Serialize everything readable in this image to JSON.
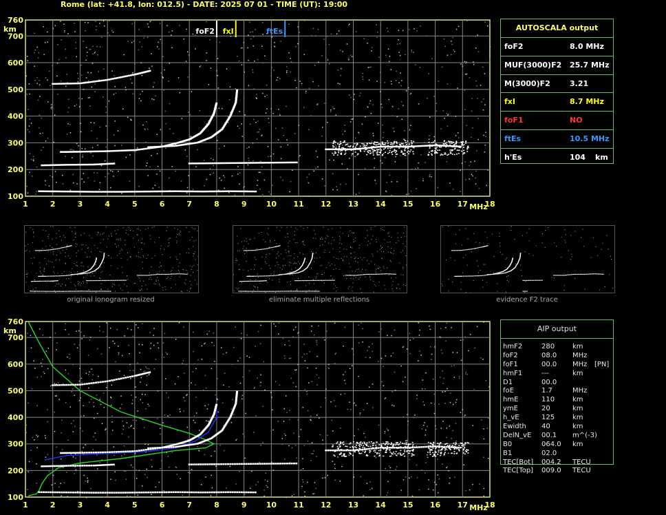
{
  "header": "Rome (lat: +41.8, lon: 012.5) - DATE: 2025 07 01 - TIME (UT): 19:00",
  "axis": {
    "y_ticks": [
      100,
      200,
      300,
      400,
      500,
      600,
      700,
      760
    ],
    "x_ticks": [
      1,
      2,
      3,
      4,
      5,
      6,
      7,
      8,
      9,
      10,
      11,
      12,
      13,
      14,
      15,
      16,
      17,
      18
    ],
    "y_unit": "km",
    "x_unit": "MHz"
  },
  "markers": {
    "foF2": {
      "label": "foF2",
      "freq": 8.0,
      "color": "#ffffff"
    },
    "fxI": {
      "label": "fxI",
      "freq": 8.7,
      "color": "#ffff00"
    },
    "ftEs": {
      "label": "ftEs",
      "freq": 10.5,
      "color": "#3399ff"
    }
  },
  "chart_data": [
    {
      "type": "scatter",
      "title": "",
      "xlabel": "MHz",
      "ylabel": "km",
      "xlim": [
        1,
        18
      ],
      "ylim": [
        100,
        760
      ],
      "grid": true,
      "series": [
        {
          "name": "",
          "color": "#ffffff",
          "points": [
            [
              2.3,
              265
            ],
            [
              3,
              266
            ],
            [
              4,
              268
            ],
            [
              5,
              272
            ],
            [
              6,
              285
            ],
            [
              6.6,
              300
            ],
            [
              7,
              312
            ],
            [
              7.4,
              335
            ],
            [
              7.7,
              370
            ],
            [
              7.9,
              410
            ],
            [
              8.0,
              450
            ]
          ]
        },
        {
          "name": "",
          "color": "#ffffff",
          "points": [
            [
              5.5,
              283
            ],
            [
              6.5,
              288
            ],
            [
              7.3,
              300
            ],
            [
              7.8,
              320
            ],
            [
              8.2,
              350
            ],
            [
              8.5,
              400
            ],
            [
              8.7,
              450
            ],
            [
              8.75,
              500
            ]
          ]
        },
        {
          "name": "",
          "color": "#ffffff",
          "points": [
            [
              2,
              520
            ],
            [
              3,
              522
            ],
            [
              4,
              535
            ],
            [
              5,
              555
            ],
            [
              5.6,
              570
            ]
          ]
        },
        {
          "name": "",
          "color": "#ffffff",
          "points": [
            [
              1.6,
              215
            ],
            [
              2.5,
              217
            ],
            [
              3.5,
              218
            ],
            [
              4.3,
              222
            ]
          ]
        },
        {
          "name": "",
          "color": "#ffffff",
          "points": [
            [
              7,
              222
            ],
            [
              8,
              223
            ],
            [
              9,
              224
            ],
            [
              10,
              225
            ],
            [
              11,
              226
            ]
          ]
        },
        {
          "name": "",
          "color": "#ffffff",
          "points": [
            [
              1.5,
              118
            ],
            [
              2.5,
              117
            ],
            [
              3.5,
              116
            ],
            [
              4.5,
              116
            ],
            [
              5.5,
              117
            ],
            [
              6.5,
              118
            ],
            [
              7.5,
              117
            ],
            [
              8.5,
              118
            ],
            [
              9.5,
              117
            ]
          ]
        },
        {
          "name": "",
          "color": "#ffffff",
          "points": [
            [
              12,
              275
            ],
            [
              13,
              275
            ],
            [
              14,
              285
            ],
            [
              15,
              285
            ],
            [
              16,
              290
            ],
            [
              17,
              285
            ]
          ]
        }
      ]
    },
    {
      "type": "line",
      "title": "",
      "xlabel": "MHz",
      "ylabel": "km",
      "xlim": [
        1,
        18
      ],
      "ylim": [
        100,
        760
      ],
      "grid": true,
      "series": [
        {
          "name": "",
          "color": "#22dd22",
          "points": [
            [
              1.1,
              760
            ],
            [
              1.5,
              680
            ],
            [
              2,
              590
            ],
            [
              3,
              500
            ],
            [
              4.5,
              420
            ],
            [
              6,
              370
            ],
            [
              7,
              340
            ],
            [
              7.6,
              315
            ],
            [
              7.9,
              300
            ],
            [
              7.6,
              285
            ],
            [
              6.5,
              275
            ],
            [
              4.5,
              245
            ],
            [
              3,
              228
            ],
            [
              2.2,
              210
            ],
            [
              1.8,
              180
            ],
            [
              1.6,
              150
            ],
            [
              1.5,
              125
            ],
            [
              1.4,
              112
            ],
            [
              1.1,
              105
            ]
          ]
        },
        {
          "name": "",
          "color": "#2233ff",
          "points": [
            [
              1.7,
              240
            ],
            [
              2.5,
              256
            ],
            [
              3.5,
              262
            ],
            [
              4.5,
              266
            ],
            [
              5.5,
              272
            ],
            [
              6.5,
              285
            ],
            [
              7.2,
              310
            ],
            [
              7.7,
              345
            ],
            [
              8.0,
              400
            ],
            [
              8.0,
              455
            ]
          ]
        }
      ]
    }
  ],
  "autoscala": {
    "title": "AUTOSCALA output",
    "rows": [
      {
        "label": "foF2",
        "value": "8.0 MHz",
        "unit": "",
        "color": "#ffffff"
      },
      {
        "label": "MUF(3000)F2",
        "value": "25.7 MHz",
        "unit": "",
        "color": "#ffffff"
      },
      {
        "label": "M(3000)F2",
        "value": "3.21",
        "unit": "",
        "color": "#ffffff"
      },
      {
        "label": "fxI",
        "value": "8.7 MHz",
        "unit": "",
        "color": "#ffff00"
      },
      {
        "label": "foF1",
        "value": "NO",
        "unit": "",
        "color": "#ff3333"
      },
      {
        "label": "ftEs",
        "value": "10.5 MHz",
        "unit": "",
        "color": "#3399ff"
      },
      {
        "label": "h'Es",
        "value": "104",
        "unit": "km",
        "color": "#ffffff"
      }
    ]
  },
  "thumbs": [
    {
      "caption": "original ionogram resized"
    },
    {
      "caption": "eliminate multiple reflections"
    },
    {
      "caption": "evidence F2 trace"
    }
  ],
  "aip": {
    "title": "AIP output",
    "rows": [
      [
        "hmF2",
        "280",
        "km",
        ""
      ],
      [
        "foF2",
        "08.0",
        "MHz",
        ""
      ],
      [
        "foF1",
        "00.0",
        "MHz",
        "[PN]"
      ],
      [
        "hmF1",
        "---",
        "km",
        ""
      ],
      [
        "D1",
        "00.0",
        "",
        ""
      ],
      [
        "foE",
        "1.7",
        "MHz",
        ""
      ],
      [
        "hmE",
        "110",
        "km",
        ""
      ],
      [
        "ymE",
        "20",
        "km",
        ""
      ],
      [
        "h_vE",
        "125",
        "km",
        ""
      ],
      [
        "Ewidth",
        "40",
        "km",
        ""
      ],
      [
        "DelN_vE",
        "00.1",
        "m^(-3)",
        ""
      ],
      [
        "B0",
        "064.0",
        "km",
        ""
      ],
      [
        "B1",
        "02.0",
        "",
        ""
      ],
      [
        "TEC[Bot]",
        "004.2",
        "TECU",
        ""
      ],
      [
        "TEC[Top]",
        "009.0",
        "TECU",
        ""
      ]
    ]
  }
}
